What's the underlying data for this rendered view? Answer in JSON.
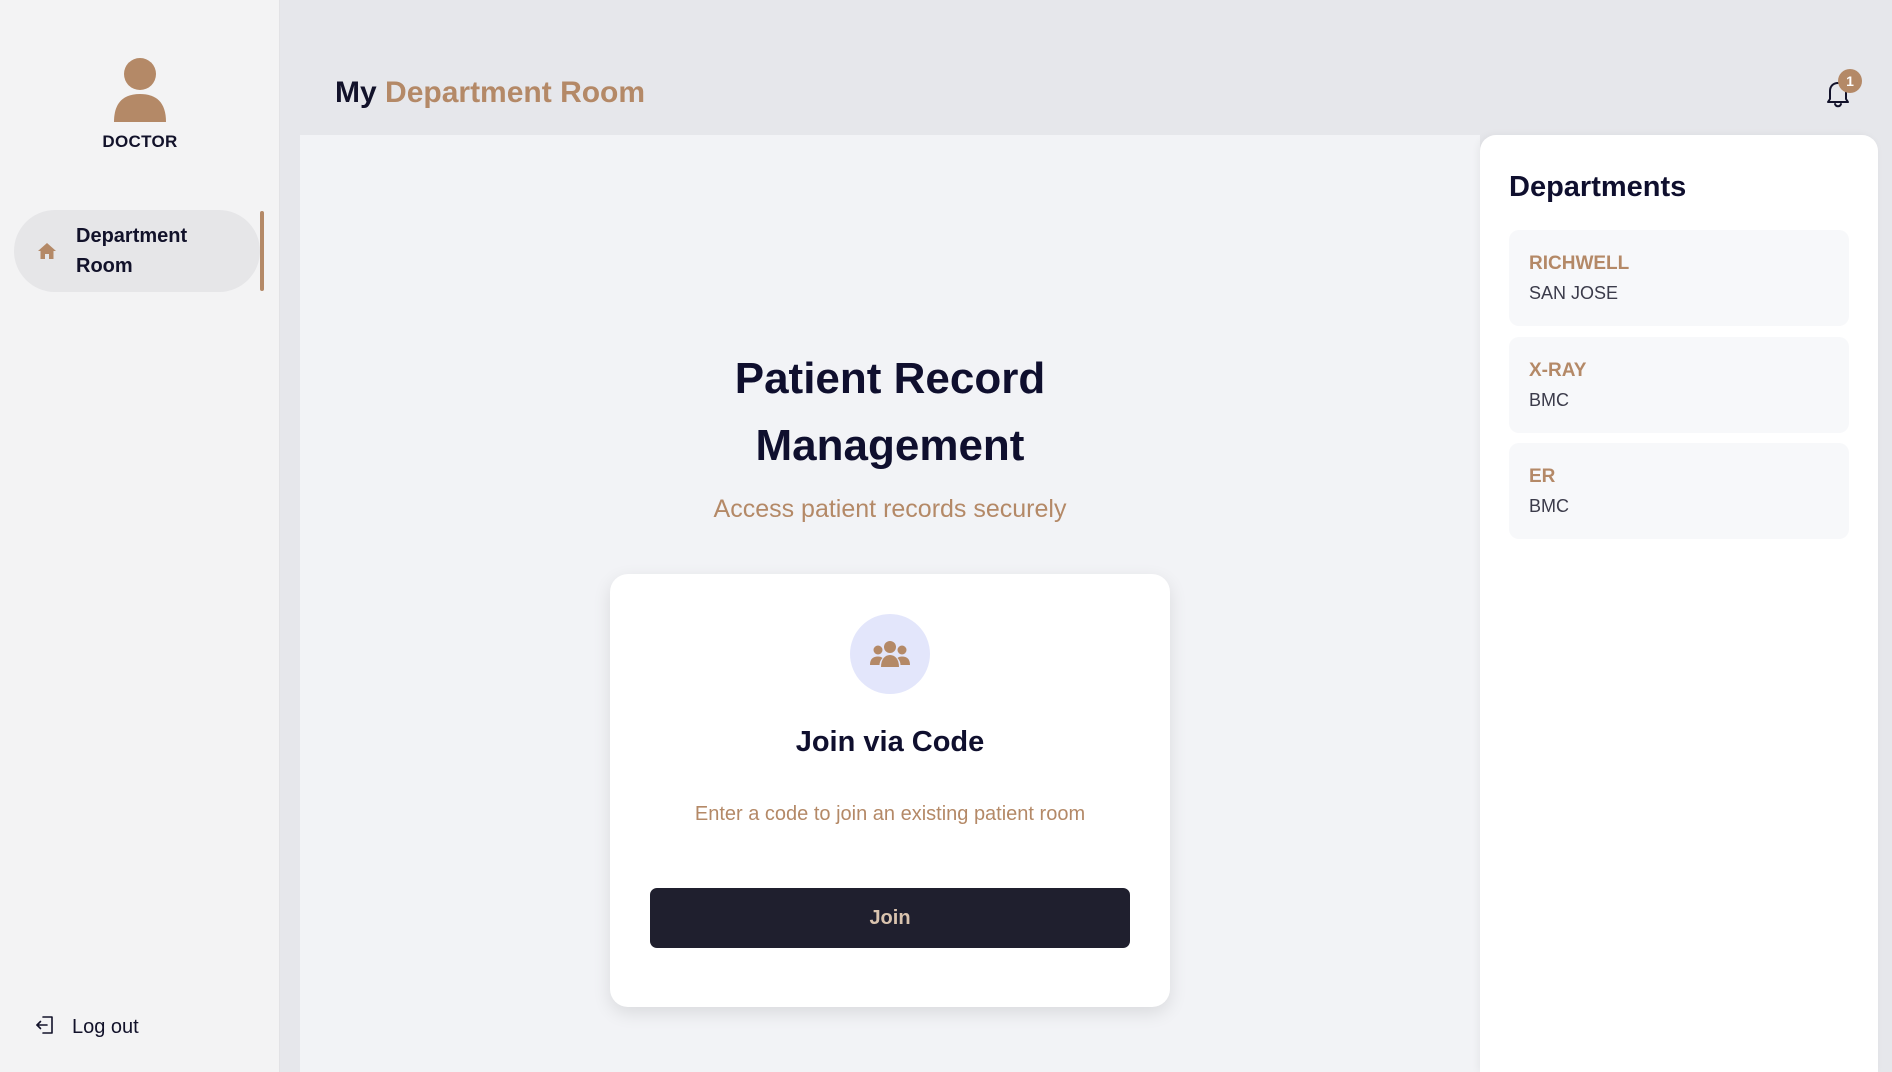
{
  "sidebar": {
    "role": "DOCTOR",
    "nav_items": [
      {
        "label": "Department Room",
        "icon": "home-icon"
      }
    ],
    "logout_label": "Log out"
  },
  "header": {
    "title_prefix": "My",
    "title_accent": "Department Room",
    "notification_count": "1"
  },
  "hero": {
    "title": "Patient Record Management",
    "subtitle": "Access patient records securely"
  },
  "join_card": {
    "icon": "users-group-icon",
    "title": "Join via Code",
    "description": "Enter a code to join an existing patient room",
    "button_label": "Join"
  },
  "departments": {
    "title": "Departments",
    "items": [
      {
        "name": "RICHWELL",
        "location": "SAN JOSE"
      },
      {
        "name": "X-RAY",
        "location": "BMC"
      },
      {
        "name": "ER",
        "location": "BMC"
      }
    ]
  },
  "colors": {
    "accent": "#b48967",
    "dark": "#0f0f2e",
    "button_bg": "#1f1f2e",
    "icon_circle_bg": "#e3e6fb"
  }
}
